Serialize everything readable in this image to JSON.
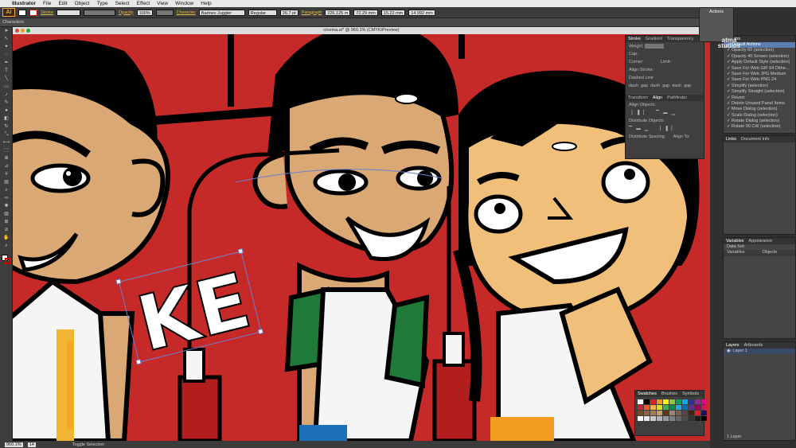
{
  "menubar": {
    "app": "Illustrator",
    "items": [
      "File",
      "Edit",
      "Object",
      "Type",
      "Select",
      "Effect",
      "View",
      "Window",
      "Help"
    ]
  },
  "control_bar": {
    "logo": "Ai",
    "characters_label": "Characters",
    "stroke_label": "Stroke",
    "opacity_label": "Opacity",
    "opacity_value": "100%",
    "character_label": "Character",
    "font_name": "Badnex Juggler",
    "font_style": "Regular",
    "font_size": "26.7 pt",
    "paragraph_label": "Paragraph",
    "x_value": "226.125 m",
    "y_value": "72.29 mm",
    "w_value": "15.22 mm",
    "h_value": "14.992 mm"
  },
  "document": {
    "title": "cinema.ai* @ 960.1% (CMYK/Preview)",
    "selected_text": "KE",
    "colors": {
      "background": "#c62a28",
      "skin": "#d9a874",
      "girl_skin": "#f0c07a",
      "outline": "#000000",
      "green_sleeve": "#1f7a3a",
      "maroon_post": "#b21e1e"
    }
  },
  "statusbar": {
    "zoom": "960.1%",
    "page": "14",
    "tool_label": "Toggle Selection"
  },
  "stroke_panel": {
    "tabs": [
      "Stroke",
      "Gradient",
      "Transparency"
    ],
    "weight_label": "Weight:",
    "cap_label": "Cap:",
    "corner_label": "Corner:",
    "limit_label": "Limit:",
    "align_stroke_label": "Align Stroke:",
    "dashed_line_label": "Dashed Line",
    "dash_cells": [
      "dash",
      "gap",
      "dash",
      "gap",
      "dash",
      "gap"
    ],
    "align_tabs": [
      "Transform",
      "Align",
      "Pathfinder"
    ],
    "align_objects_label": "Align Objects:",
    "distribute_objects_label": "Distribute Objects:",
    "distribute_spacing_label": "Distribute Spacing:",
    "align_to_label": "Align To:"
  },
  "actions_panel": {
    "icon_label": "Actions",
    "tab": "Actions",
    "watermark": "atma studios",
    "items": [
      "Default Actions",
      "Opacity 60 (selection)",
      "Opacity 40 Screen (selection)",
      "Apply Default Style (selection)",
      "Save For Web GIF 64 Dithe...",
      "Save For Web JPG Medium",
      "Save For Web PNG 24",
      "Simplify (selection)",
      "Simplify Straight (selection)",
      "Revert",
      "Delete Unused Panel Items",
      "Move Dialog (selection)",
      "Scale Dialog (selection)",
      "Rotate Dialog (selection)",
      "Rotate 90 CW (selection)"
    ]
  },
  "links_panel": {
    "tabs": [
      "Links",
      "Document Info"
    ]
  },
  "variables_panel": {
    "tabs": [
      "Variables",
      "Appearance"
    ],
    "dataset_label": "Data Set:",
    "columns": [
      "Variables",
      "Objects"
    ]
  },
  "layers_panel": {
    "tabs": [
      "Layers",
      "Artboards"
    ],
    "layer_name": "Layer 1",
    "footer": "1 Layer"
  },
  "swatches_panel": {
    "tabs": [
      "Swatches",
      "Brushes",
      "Symbols"
    ],
    "colors": [
      "#ffffff",
      "#000000",
      "#e41e26",
      "#f7941d",
      "#fff200",
      "#8dc63f",
      "#00a651",
      "#00aeef",
      "#2e3192",
      "#92278f",
      "#ec008c",
      "#c1272d",
      "#f15a24",
      "#fbb03b",
      "#d9e021",
      "#39b54a",
      "#009245",
      "#29abe2",
      "#0071bc",
      "#662d91",
      "#9e005d",
      "#d4145a",
      "#754c24",
      "#8c6239",
      "#a67c52",
      "#c69c6d",
      "#603813",
      "#998675",
      "#736357",
      "#534741",
      "#42210b",
      "#ed1c24",
      "#1b1464",
      "#ffffff",
      "#e6e6e6",
      "#cccccc",
      "#b3b3b3",
      "#999999",
      "#808080",
      "#666666",
      "#4d4d4d",
      "#333333",
      "#1a1a1a",
      "#000000"
    ]
  }
}
